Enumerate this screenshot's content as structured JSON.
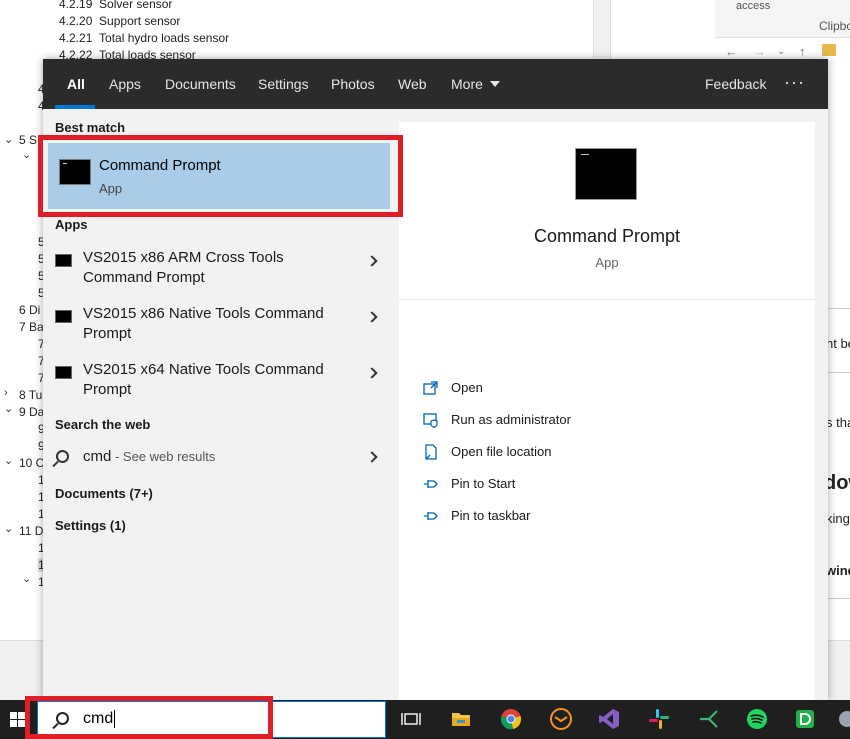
{
  "background_doc": {
    "toc_items": [
      {
        "num": "4.2.19",
        "text": "Solver sensor"
      },
      {
        "num": "4.2.20",
        "text": "Support sensor"
      },
      {
        "num": "4.2.21",
        "text": "Total hydro loads sensor"
      },
      {
        "num": "4.2.22",
        "text": "Total loads sensor"
      }
    ],
    "side_fragments": [
      {
        "text": "4"
      },
      {
        "text": "4"
      },
      {
        "text": "5 S"
      },
      {
        "text": "5"
      },
      {
        "text": "5"
      },
      {
        "text": "5"
      },
      {
        "text": "5"
      },
      {
        "text": "6 Di"
      },
      {
        "text": "7 Ba"
      },
      {
        "text": "7"
      },
      {
        "text": "7"
      },
      {
        "text": "7"
      },
      {
        "text": "8 Tu"
      },
      {
        "text": "9 Da"
      },
      {
        "text": "9"
      },
      {
        "text": "9"
      },
      {
        "text": "10 C"
      },
      {
        "text": "1"
      },
      {
        "text": "1"
      },
      {
        "text": "1"
      },
      {
        "text": "11 D"
      },
      {
        "text": "1"
      },
      {
        "text": "1"
      },
      {
        "text": "1"
      }
    ],
    "ribbon_text": "access",
    "clipboard_label": "Clipbo",
    "right_snippets": [
      {
        "text": "ht be"
      },
      {
        "text": "s tha"
      },
      {
        "text": "dow"
      },
      {
        "text": "king"
      },
      {
        "text": "wind"
      }
    ]
  },
  "menu": {
    "tabs": [
      {
        "label": "All",
        "active": true
      },
      {
        "label": "Apps"
      },
      {
        "label": "Documents"
      },
      {
        "label": "Settings"
      },
      {
        "label": "Photos"
      },
      {
        "label": "Web"
      },
      {
        "label": "More"
      }
    ],
    "feedback_label": "Feedback",
    "more_options": "···",
    "best_match_heading": "Best match",
    "best_match": {
      "title": "Command Prompt",
      "subtitle": "App"
    },
    "apps_heading": "Apps",
    "apps": [
      {
        "line1": "VS2015 x86 ARM Cross Tools",
        "line2": "Command Prompt"
      },
      {
        "line1": "VS2015 x86 Native Tools Command",
        "line2": "Prompt"
      },
      {
        "line1": "VS2015 x64 Native Tools Command",
        "line2": "Prompt"
      }
    ],
    "search_web_heading": "Search the web",
    "web_query": "cmd",
    "web_hint": " - See web results",
    "documents_heading": "Documents (7+)",
    "settings_heading": "Settings (1)"
  },
  "preview": {
    "title": "Command Prompt",
    "subtitle": "App",
    "actions": [
      {
        "label": "Open",
        "icon": "open-icon"
      },
      {
        "label": "Run as administrator",
        "icon": "admin-shield-icon"
      },
      {
        "label": "Open file location",
        "icon": "file-location-icon"
      },
      {
        "label": "Pin to Start",
        "icon": "pin-icon"
      },
      {
        "label": "Pin to taskbar",
        "icon": "pin-icon"
      }
    ]
  },
  "taskbar": {
    "search_value": "cmd",
    "pinned": [
      "task-view-icon",
      "file-explorer-icon",
      "chrome-icon",
      "mail-client-icon",
      "visual-studio-icon",
      "slack-icon",
      "git-icon",
      "spotify-icon",
      "dev-app-icon",
      "extra-app-icon"
    ]
  },
  "colors": {
    "accent": "#0078d7",
    "selection": "#a9cde8",
    "annotation_red": "#e01e26",
    "menu_header": "#2b2b2b"
  }
}
